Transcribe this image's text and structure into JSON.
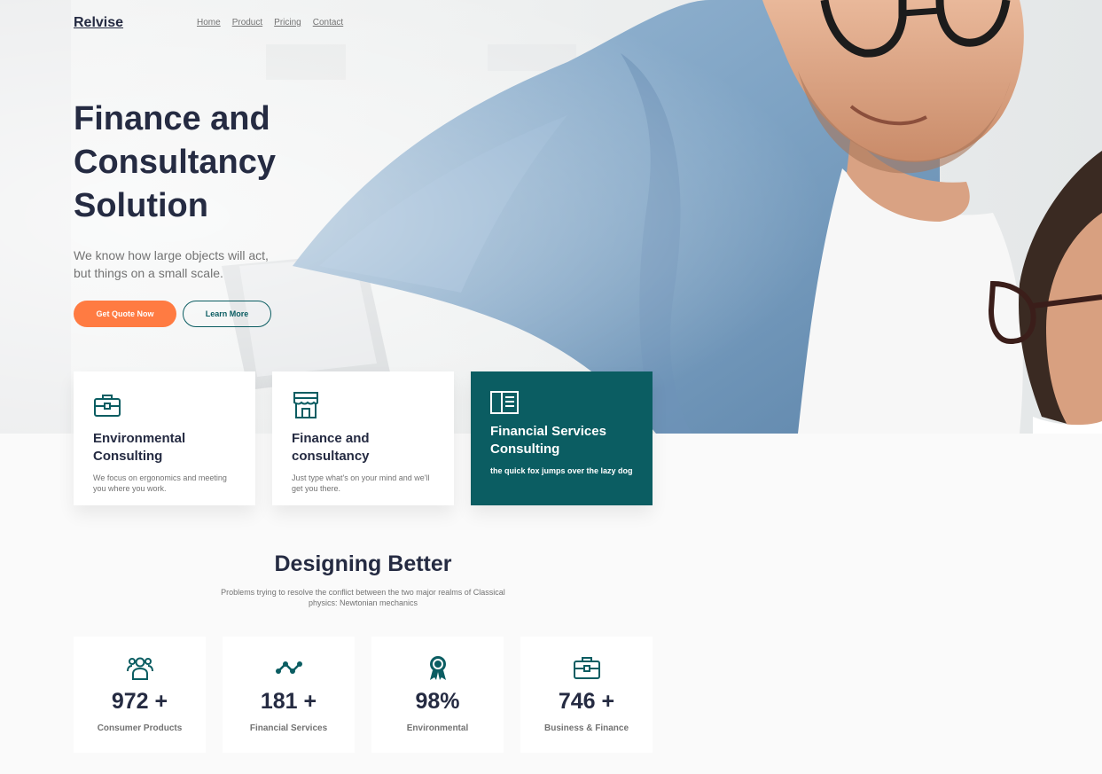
{
  "nav": {
    "brand": "Relvise",
    "links": [
      "Home",
      "Product",
      "Pricing",
      "Contact"
    ]
  },
  "hero": {
    "title": "Finance and Consultancy Solution",
    "subtitle": "We know how large objects will act, but things on a small scale.",
    "primary_button": "Get Quote Now",
    "secondary_button": "Learn More"
  },
  "cards": [
    {
      "icon": "briefcase-icon",
      "title": "Environmental Consulting",
      "text": "We focus on ergonomics and meeting you where you work."
    },
    {
      "icon": "store-icon",
      "title": "Finance and consultancy",
      "text": "Just type what's on your mind and we'll get you there."
    },
    {
      "icon": "book-open-icon",
      "title": "Financial Services Consulting",
      "text": "the quick fox jumps over the lazy dog"
    }
  ],
  "section": {
    "title": "Designing Better",
    "subtitle": "Problems trying to resolve the conflict between the two major realms of Classical physics: Newtonian mechanics"
  },
  "stats": [
    {
      "icon": "users-icon",
      "value": "972 +",
      "label": "Consumer Products"
    },
    {
      "icon": "trend-icon",
      "value": "181 +",
      "label": "Financial Services"
    },
    {
      "icon": "award-icon",
      "value": "98%",
      "label": "Environmental"
    },
    {
      "icon": "briefcase-icon",
      "value": "746 +",
      "label": "Business & Finance"
    }
  ],
  "colors": {
    "primary": "#ff7b42",
    "teal": "#0b5d62",
    "dark": "#252b42",
    "muted": "#737373"
  }
}
